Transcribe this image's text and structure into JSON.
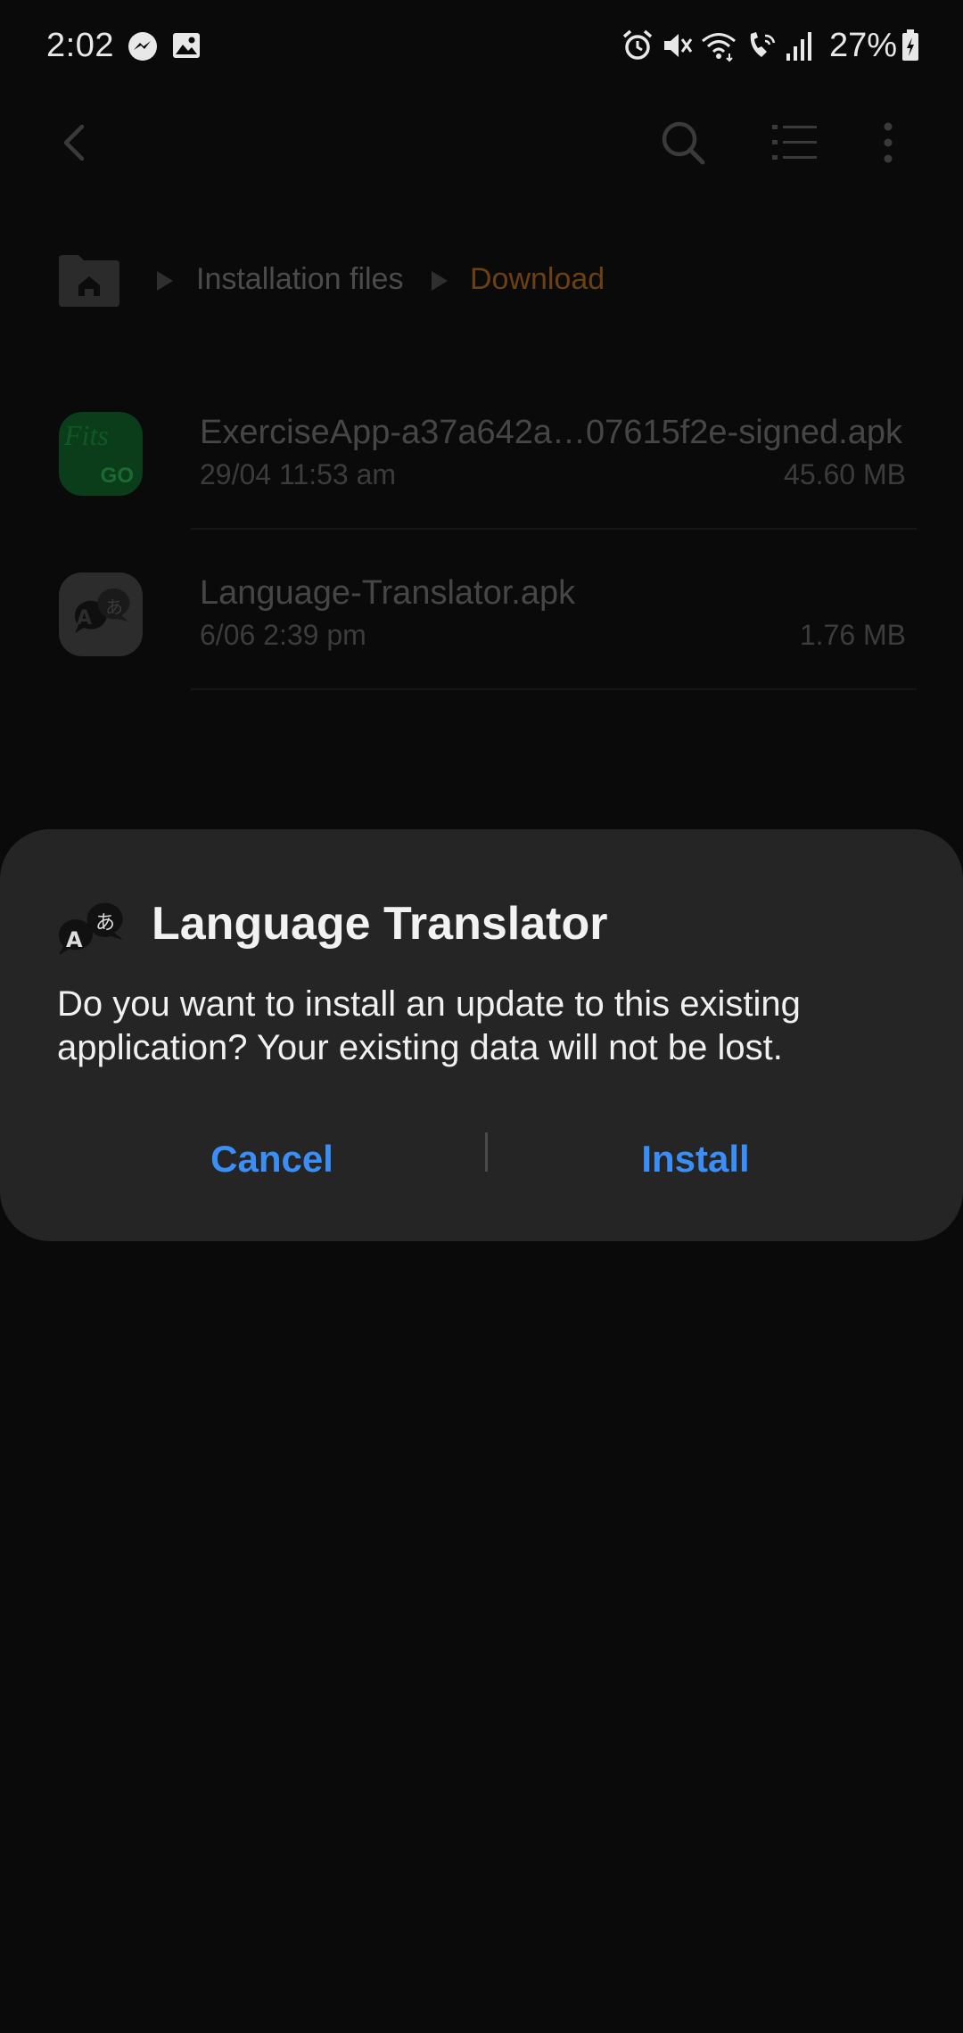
{
  "status_bar": {
    "time": "2:02",
    "battery": "27%",
    "notification_icons": [
      "messenger-icon",
      "image-icon"
    ],
    "system_icons": [
      "alarm-icon",
      "mute-icon",
      "wifi-icon",
      "wifi-calling-icon",
      "signal-icon",
      "battery-charging-icon"
    ]
  },
  "app_bar": {
    "icons": [
      "back-icon",
      "search-icon",
      "list-view-icon",
      "more-options-icon"
    ]
  },
  "breadcrumb": {
    "items": [
      "Installation files",
      "Download"
    ],
    "current_color": "#6b4012"
  },
  "files": [
    {
      "name": "ExerciseApp-a37a642a…07615f2e-signed.apk",
      "date": "29/04 11:53 am",
      "size": "45.60 MB",
      "icon": "fitsgo-app-icon",
      "icon_text": "Fits",
      "icon_subtext": "GO"
    },
    {
      "name": "Language-Translator.apk",
      "date": "6/06 2:39 pm",
      "size": "1.76 MB",
      "icon": "translator-app-icon"
    }
  ],
  "dialog": {
    "title": "Language Translator",
    "message": "Do you want to install an update to this existing application? Your existing data will not be lost.",
    "cancel_label": "Cancel",
    "install_label": "Install",
    "accent_color": "#3a8ef6"
  }
}
